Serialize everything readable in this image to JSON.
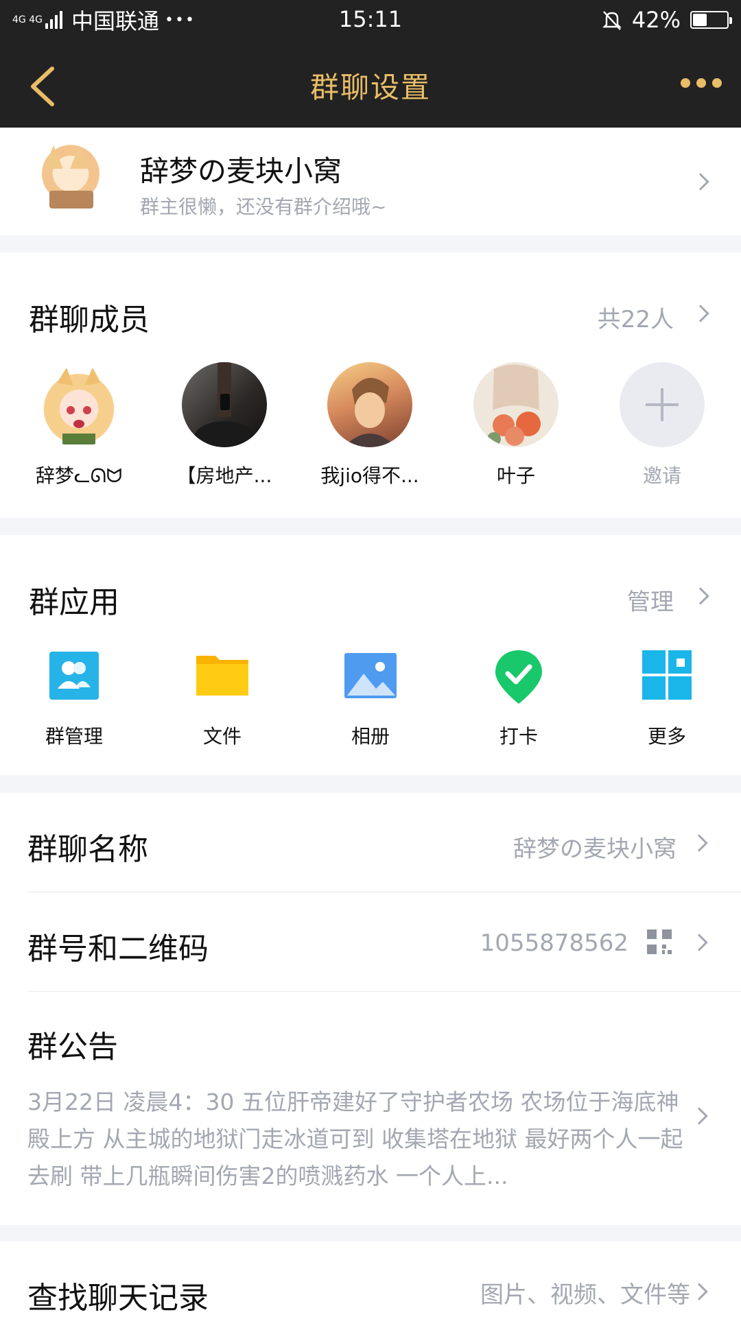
{
  "status_bar": {
    "network": "4G 4G",
    "carrier": "中国联通",
    "more": "•••",
    "time": "15:11",
    "battery": "42%",
    "battery_level": 0.42
  },
  "nav": {
    "title": "群聊设置",
    "accent_color": "#e9bd67"
  },
  "group": {
    "name": "辞梦の麦块小窝",
    "description": "群主很懒，还没有群介绍哦~"
  },
  "members": {
    "title": "群聊成员",
    "count_label": "共22人",
    "items": [
      {
        "name": "辞梦ᓚᘏᗢ"
      },
      {
        "name": "【房地产..."
      },
      {
        "name": "我jio得不..."
      },
      {
        "name": "叶子"
      },
      {
        "name": "邀请"
      }
    ]
  },
  "apps": {
    "title": "群应用",
    "manage_label": "管理",
    "items": [
      {
        "label": "群管理",
        "icon": "group-manage-icon"
      },
      {
        "label": "文件",
        "icon": "folder-icon"
      },
      {
        "label": "相册",
        "icon": "photo-album-icon"
      },
      {
        "label": "打卡",
        "icon": "check-in-icon"
      },
      {
        "label": "更多",
        "icon": "more-grid-icon"
      }
    ]
  },
  "settings": {
    "group_name": {
      "label": "群聊名称",
      "value": "辞梦の麦块小窝"
    },
    "group_number": {
      "label": "群号和二维码",
      "value": "1055878562"
    },
    "notice": {
      "label": "群公告",
      "text": "3月22日 凌晨4：30 五位肝帝建好了守护者农场 农场位于海底神殿上方 从主城的地狱门走冰道可到 收集塔在地狱 最好两个人一起去刷 带上几瓶瞬间伤害2的喷溅药水 一个人上..."
    },
    "search_history": {
      "label": "查找聊天记录",
      "value": "图片、视频、文件等"
    }
  }
}
